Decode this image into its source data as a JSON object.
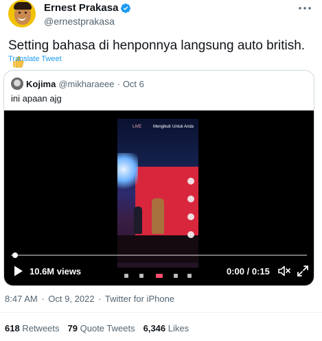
{
  "author": {
    "display_name": "Ernest Prakasa",
    "handle": "@ernestprakasa",
    "verified": true
  },
  "tweet": {
    "text": "Setting bahasa di henponnya langsung auto british.",
    "emoji": "thumbs-up",
    "translate_label": "Translate Tweet"
  },
  "quote": {
    "display_name": "Kojima",
    "handle": "@mikharaeee",
    "dot": "·",
    "date": "Oct 6",
    "text": "ini apaan ajg",
    "video": {
      "views": "10.6M views",
      "time": "0:00 / 0:15",
      "progress": 0.0,
      "phone_screen": {
        "tab1": "LIVE",
        "tab2": "Mengikuti",
        "tab3": "Untuk Anda"
      }
    }
  },
  "meta": {
    "time": "8:47 AM",
    "dot": "·",
    "date": "Oct 9, 2022",
    "source": "Twitter for iPhone"
  },
  "stats": {
    "retweets_count": "618",
    "retweets_label": "Retweets",
    "quotes_count": "79",
    "quotes_label": "Quote Tweets",
    "likes_count": "6,346",
    "likes_label": "Likes"
  },
  "colors": {
    "link": "#1d9bf0",
    "secondary_text": "#536471",
    "border": "#cfd9de",
    "verified": "#1d9bf0"
  }
}
